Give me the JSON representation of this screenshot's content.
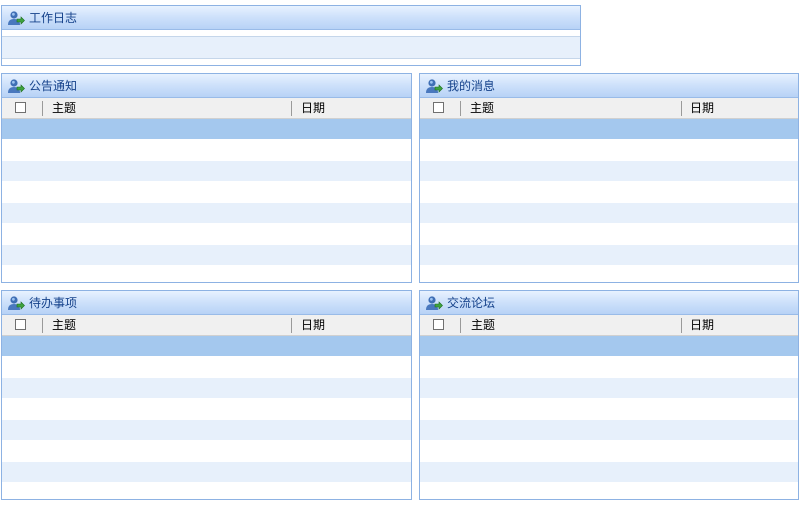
{
  "work_log": {
    "title": "工作日志"
  },
  "grid_columns": {
    "subject": "主题",
    "date": "日期"
  },
  "panels": {
    "announcements": {
      "title": "公告通知"
    },
    "messages": {
      "title": "我的消息"
    },
    "todo": {
      "title": "待办事项"
    },
    "forum": {
      "title": "交流论坛"
    }
  },
  "colors": {
    "panel_border": "#8db2e3",
    "header_gradient_top": "#e8f2ff",
    "header_gradient_bottom": "#b7d2f6",
    "title_text": "#15428b",
    "selected_row": "#a4c8ee",
    "alt_row": "#e7f0fb"
  },
  "icons": {
    "panel_icon": "user-arrow-icon"
  }
}
